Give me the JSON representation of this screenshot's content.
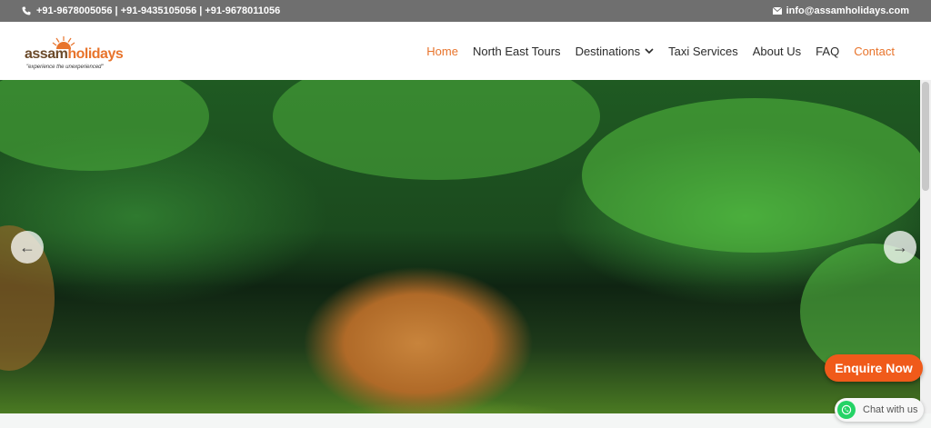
{
  "topbar": {
    "phone_icon": "phone-icon",
    "phones": "+91-9678005056 | +91-9435105056 | +91-9678011056",
    "email_icon": "envelope-icon",
    "email": "info@assamholidays.com"
  },
  "logo": {
    "part1": "assam",
    "part2": "holidays",
    "tagline": "\"experience the unexperienced\""
  },
  "nav": {
    "home": "Home",
    "north_east_tours": "North East Tours",
    "destinations": "Destinations",
    "taxi_services": "Taxi Services",
    "about_us": "About Us",
    "faq": "FAQ",
    "contact": "Contact"
  },
  "slider": {
    "prev_symbol": "←",
    "next_symbol": "→"
  },
  "floating": {
    "enquire": "Enquire Now",
    "chat": "Chat with us"
  },
  "colors": {
    "accent": "#e8742c",
    "enquire_bg": "#f05a1a",
    "topbar_bg": "#6f6f6f",
    "whatsapp": "#25d366"
  }
}
